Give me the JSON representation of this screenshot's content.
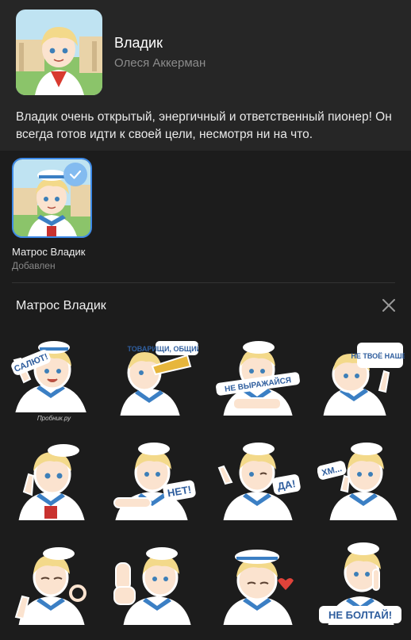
{
  "pack": {
    "title": "Владик",
    "author": "Олеся Аккерман",
    "description": "Владик очень открытый, энергичный и ответственный пионер! Он всегда готов идти к своей цели, несмотря ни на что."
  },
  "variant": {
    "name": "Матрос Владик",
    "status": "Добавлен"
  },
  "sticker_section": {
    "title": "Матрос Владик"
  },
  "stickers": [
    {
      "caption": "САЛЮТ!",
      "sub": "Пробник.ру"
    },
    {
      "caption": "ТОВАРИЩИ, ОБЩИЙ СБОР!"
    },
    {
      "caption": "НЕ ВЫРАЖАЙСЯ"
    },
    {
      "caption": "НЕ ТВОЁ НАШЕ!"
    },
    {
      "caption": ""
    },
    {
      "caption": "НЕТ!"
    },
    {
      "caption": "ДА!"
    },
    {
      "caption": "ХМ..."
    },
    {
      "caption": ""
    },
    {
      "caption": ""
    },
    {
      "caption": ""
    },
    {
      "caption": "НЕ БОЛТАЙ!"
    }
  ],
  "colors": {
    "accent": "#3d8ae8",
    "hair": "#f3d98a",
    "skin": "#fbe3cf",
    "sailor_blue": "#3b7fc4",
    "stripe_red": "#c9322f"
  }
}
